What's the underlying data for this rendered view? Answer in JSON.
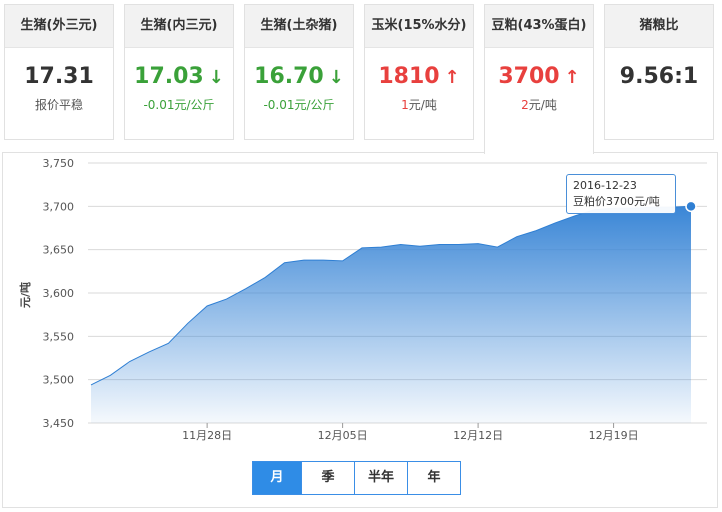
{
  "cards": [
    {
      "title": "生猪(外三元)",
      "value": "17.31",
      "arrow": "",
      "sub": "报价平稳",
      "dir": "neutral"
    },
    {
      "title": "生猪(内三元)",
      "value": "17.03",
      "arrow": "↓",
      "sub": "-0.01元/公斤",
      "dir": "down"
    },
    {
      "title": "生猪(土杂猪)",
      "value": "16.70",
      "arrow": "↓",
      "sub": "-0.01元/公斤",
      "dir": "down"
    },
    {
      "title": "玉米(15%水分)",
      "value": "1810",
      "arrow": "↑",
      "sub": "1元/吨",
      "dir": "up"
    },
    {
      "title": "豆粕(43%蛋白)",
      "value": "3700",
      "arrow": "↑",
      "sub": "2元/吨",
      "dir": "up"
    },
    {
      "title": "猪粮比",
      "value": "9.56:1",
      "arrow": "",
      "sub": "",
      "dir": "neutral"
    }
  ],
  "tooltip": {
    "date": "2016-12-23",
    "text": "豆粕价3700元/吨"
  },
  "range_buttons": [
    "月",
    "季",
    "半年",
    "年"
  ],
  "colors": {
    "up": "#e8403e",
    "down": "#3aa139",
    "accent": "#2f8ce6",
    "area": "#3a86d6"
  },
  "chart_data": {
    "type": "area",
    "title": "",
    "xlabel": "",
    "ylabel": "元/吨",
    "ylim": [
      3450,
      3750
    ],
    "yticks": [
      3450,
      3500,
      3550,
      3600,
      3650,
      3700,
      3750
    ],
    "ytick_labels": [
      "3,450",
      "3,500",
      "3,550",
      "3,600",
      "3,650",
      "3,700",
      "3,750"
    ],
    "xtick_labels": [
      {
        "label": "11月28日",
        "day": 6
      },
      {
        "label": "12月05日",
        "day": 13
      },
      {
        "label": "12月12日",
        "day": 20
      },
      {
        "label": "12月19日",
        "day": 27
      }
    ],
    "x": [
      "11-22",
      "11-23",
      "11-24",
      "11-25",
      "11-26",
      "11-27",
      "11-28",
      "11-29",
      "11-30",
      "12-01",
      "12-02",
      "12-03",
      "12-04",
      "12-05",
      "12-06",
      "12-07",
      "12-08",
      "12-09",
      "12-10",
      "12-11",
      "12-12",
      "12-13",
      "12-14",
      "12-15",
      "12-16",
      "12-17",
      "12-18",
      "12-19",
      "12-20",
      "12-21",
      "12-22",
      "12-23"
    ],
    "series": [
      {
        "values": [
          3494,
          3505,
          3521,
          3532,
          3542,
          3565,
          3585,
          3593,
          3605,
          3618,
          3635,
          3638,
          3638,
          3637,
          3652,
          3653,
          3656,
          3654,
          3656,
          3656,
          3657,
          3653,
          3665,
          3672,
          3681,
          3689,
          3696,
          3698,
          3698,
          3699,
          3699,
          3700
        ]
      }
    ],
    "grid": true,
    "legend": "none"
  }
}
